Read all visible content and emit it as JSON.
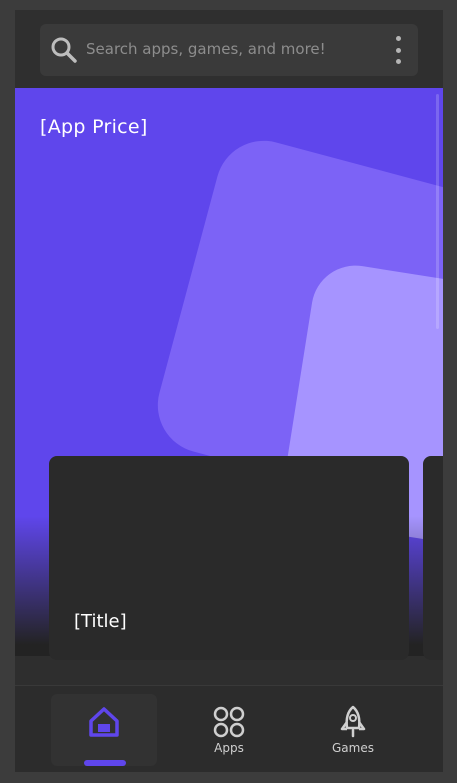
{
  "search": {
    "placeholder": "Search apps, games, and more!"
  },
  "hero": {
    "price": "[App Price]"
  },
  "cards": [
    {
      "title": "[Title]"
    },
    {
      "title": ""
    }
  ],
  "nav": {
    "items": [
      {
        "label": "",
        "icon": "home-icon",
        "active": true
      },
      {
        "label": "Apps",
        "icon": "apps-grid-icon",
        "active": false
      },
      {
        "label": "Games",
        "icon": "rocket-icon",
        "active": false
      }
    ]
  },
  "colors": {
    "accent": "#5f46ec",
    "background": "#2e2e2e",
    "card": "#2a2a2a"
  }
}
